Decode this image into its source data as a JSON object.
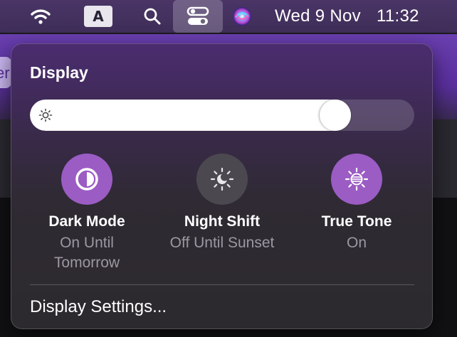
{
  "menubar": {
    "icons": [
      "wifi-icon",
      "search-icon",
      "control-center-icon",
      "siri-icon"
    ],
    "input_source": "A",
    "date": "Wed 9 Nov",
    "time": "11:32"
  },
  "background": {
    "partial_text": "er"
  },
  "display_panel": {
    "title": "Display",
    "brightness": 0.82,
    "accent_color": "#9b5cc4",
    "toggles": [
      {
        "name": "Dark Mode",
        "status_line1": "On Until",
        "status_line2": "Tomorrow",
        "state": "on",
        "icon": "dark-mode-icon"
      },
      {
        "name": "Night Shift",
        "status_line1": "Off Until Sunset",
        "status_line2": "",
        "state": "off",
        "icon": "night-shift-icon"
      },
      {
        "name": "True Tone",
        "status_line1": "On",
        "status_line2": "",
        "state": "on",
        "icon": "true-tone-icon"
      }
    ],
    "settings_link": "Display Settings..."
  }
}
